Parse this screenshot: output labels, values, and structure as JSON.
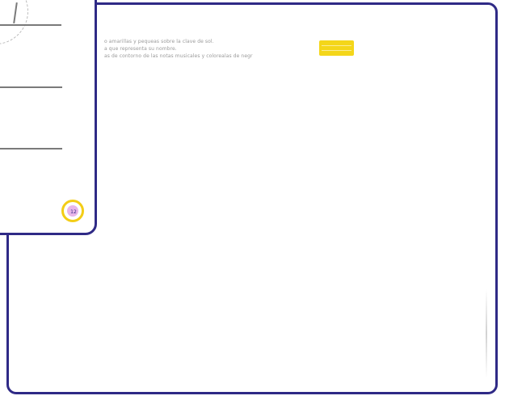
{
  "page": {
    "text_lines": [
      "o amarillas y pequeas sobre la clave de sol.",
      "a que representa su nombre.",
      "as de contorno de las notas musicales y colorealas de negr"
    ],
    "page_number": "12"
  },
  "colors": {
    "card_border": "#2f2a86",
    "highlight": "#f4d61a",
    "page_badge_ring": "#f3cd17",
    "page_badge_fill": "#e8b6ea"
  }
}
